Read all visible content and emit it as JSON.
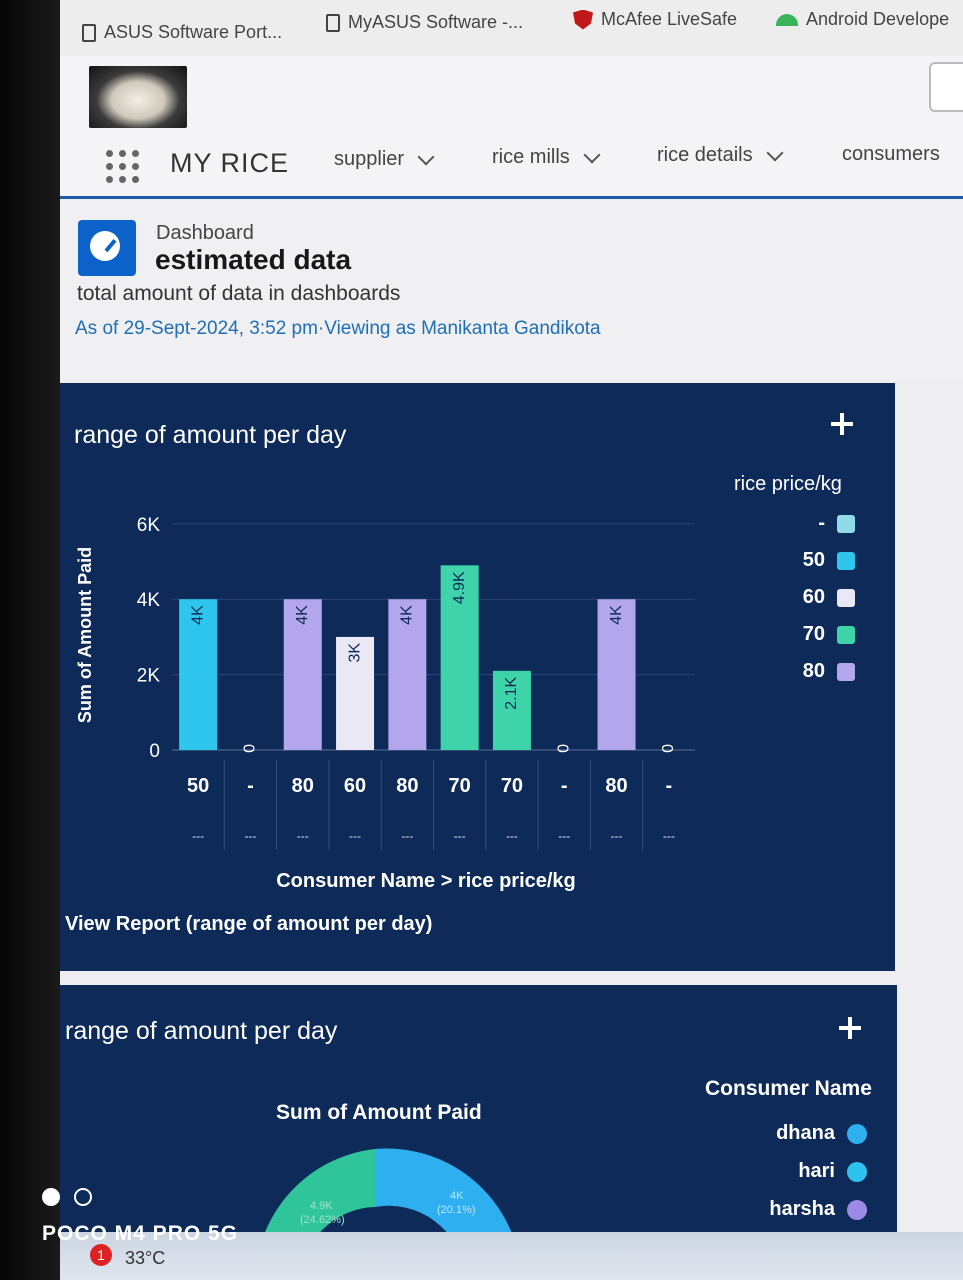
{
  "bookmarks": [
    {
      "label": "ASUS Software Port...",
      "icon": "page-icon"
    },
    {
      "label": "MyASUS Software -...",
      "icon": "page-icon"
    },
    {
      "label": "McAfee LiveSafe",
      "icon": "mcafee-shield-icon"
    },
    {
      "label": "Android Develope",
      "icon": "android-icon"
    }
  ],
  "nav": {
    "app_name": "MY RICE",
    "items": [
      "supplier",
      "rice mills",
      "rice details",
      "consumers"
    ]
  },
  "page": {
    "breadcrumb": "Dashboard",
    "title": "estimated data",
    "description": "total amount of data in dashboards",
    "meta": "As of 29-Sept-2024, 3:52 pm·Viewing as Manikanta Gandikota"
  },
  "widget1": {
    "title": "range of amount per day",
    "view_report": "View Report (range of amount per day)",
    "legend_title": "rice price/kg",
    "legend": [
      {
        "label": "-",
        "color": "#8fdce8"
      },
      {
        "label": "50",
        "color": "#2ec6ec"
      },
      {
        "label": "60",
        "color": "#e9e8f4"
      },
      {
        "label": "70",
        "color": "#3ed3a8"
      },
      {
        "label": "80",
        "color": "#b4a6ec"
      }
    ]
  },
  "chart_data": {
    "type": "bar",
    "xlabel": "Consumer Name > rice price/kg",
    "ylabel": "Sum of Amount Paid",
    "yticks": [
      "0",
      "2K",
      "4K",
      "6K"
    ],
    "ylim": [
      0,
      6500
    ],
    "categories": [
      "50",
      "-",
      "80",
      "60",
      "80",
      "70",
      "70",
      "-",
      "80",
      "-"
    ],
    "sub_labels": [
      "---",
      "---",
      "---",
      "---",
      "---",
      "---",
      "---",
      "---",
      "---",
      "---"
    ],
    "values": [
      4000,
      0,
      4000,
      3000,
      4000,
      4900,
      2100,
      0,
      4000,
      0
    ],
    "data_labels": [
      "4K",
      "0",
      "4K",
      "3K",
      "4K",
      "4.9K",
      "2.1K",
      "0",
      "4K",
      "0"
    ],
    "colors": [
      "#2ec6ec",
      "#8fdce8",
      "#b4a6ec",
      "#e9e8f4",
      "#b4a6ec",
      "#3ed3a8",
      "#3ed3a8",
      "#8fdce8",
      "#b4a6ec",
      "#8fdce8"
    ],
    "grid": true,
    "legend_position": "right"
  },
  "widget2": {
    "title": "range of amount per day",
    "chart_title": "Sum of Amount Paid",
    "legend_title": "Consumer Name",
    "legend": [
      {
        "label": "dhana",
        "color": "#2eaff0"
      },
      {
        "label": "hari",
        "color": "#2ec2ec"
      },
      {
        "label": "harsha",
        "color": "#9c8ae4"
      }
    ],
    "slices": [
      {
        "value": "4.9K",
        "percent": "(24.62%)",
        "color": "#2fc49a"
      },
      {
        "value": "4K",
        "percent": "(20.1%)",
        "color": "#2eaff0"
      }
    ]
  },
  "overlay": {
    "phone_model": "POCO M4 PRO 5G",
    "temperature": "33°C",
    "badge": "1"
  }
}
